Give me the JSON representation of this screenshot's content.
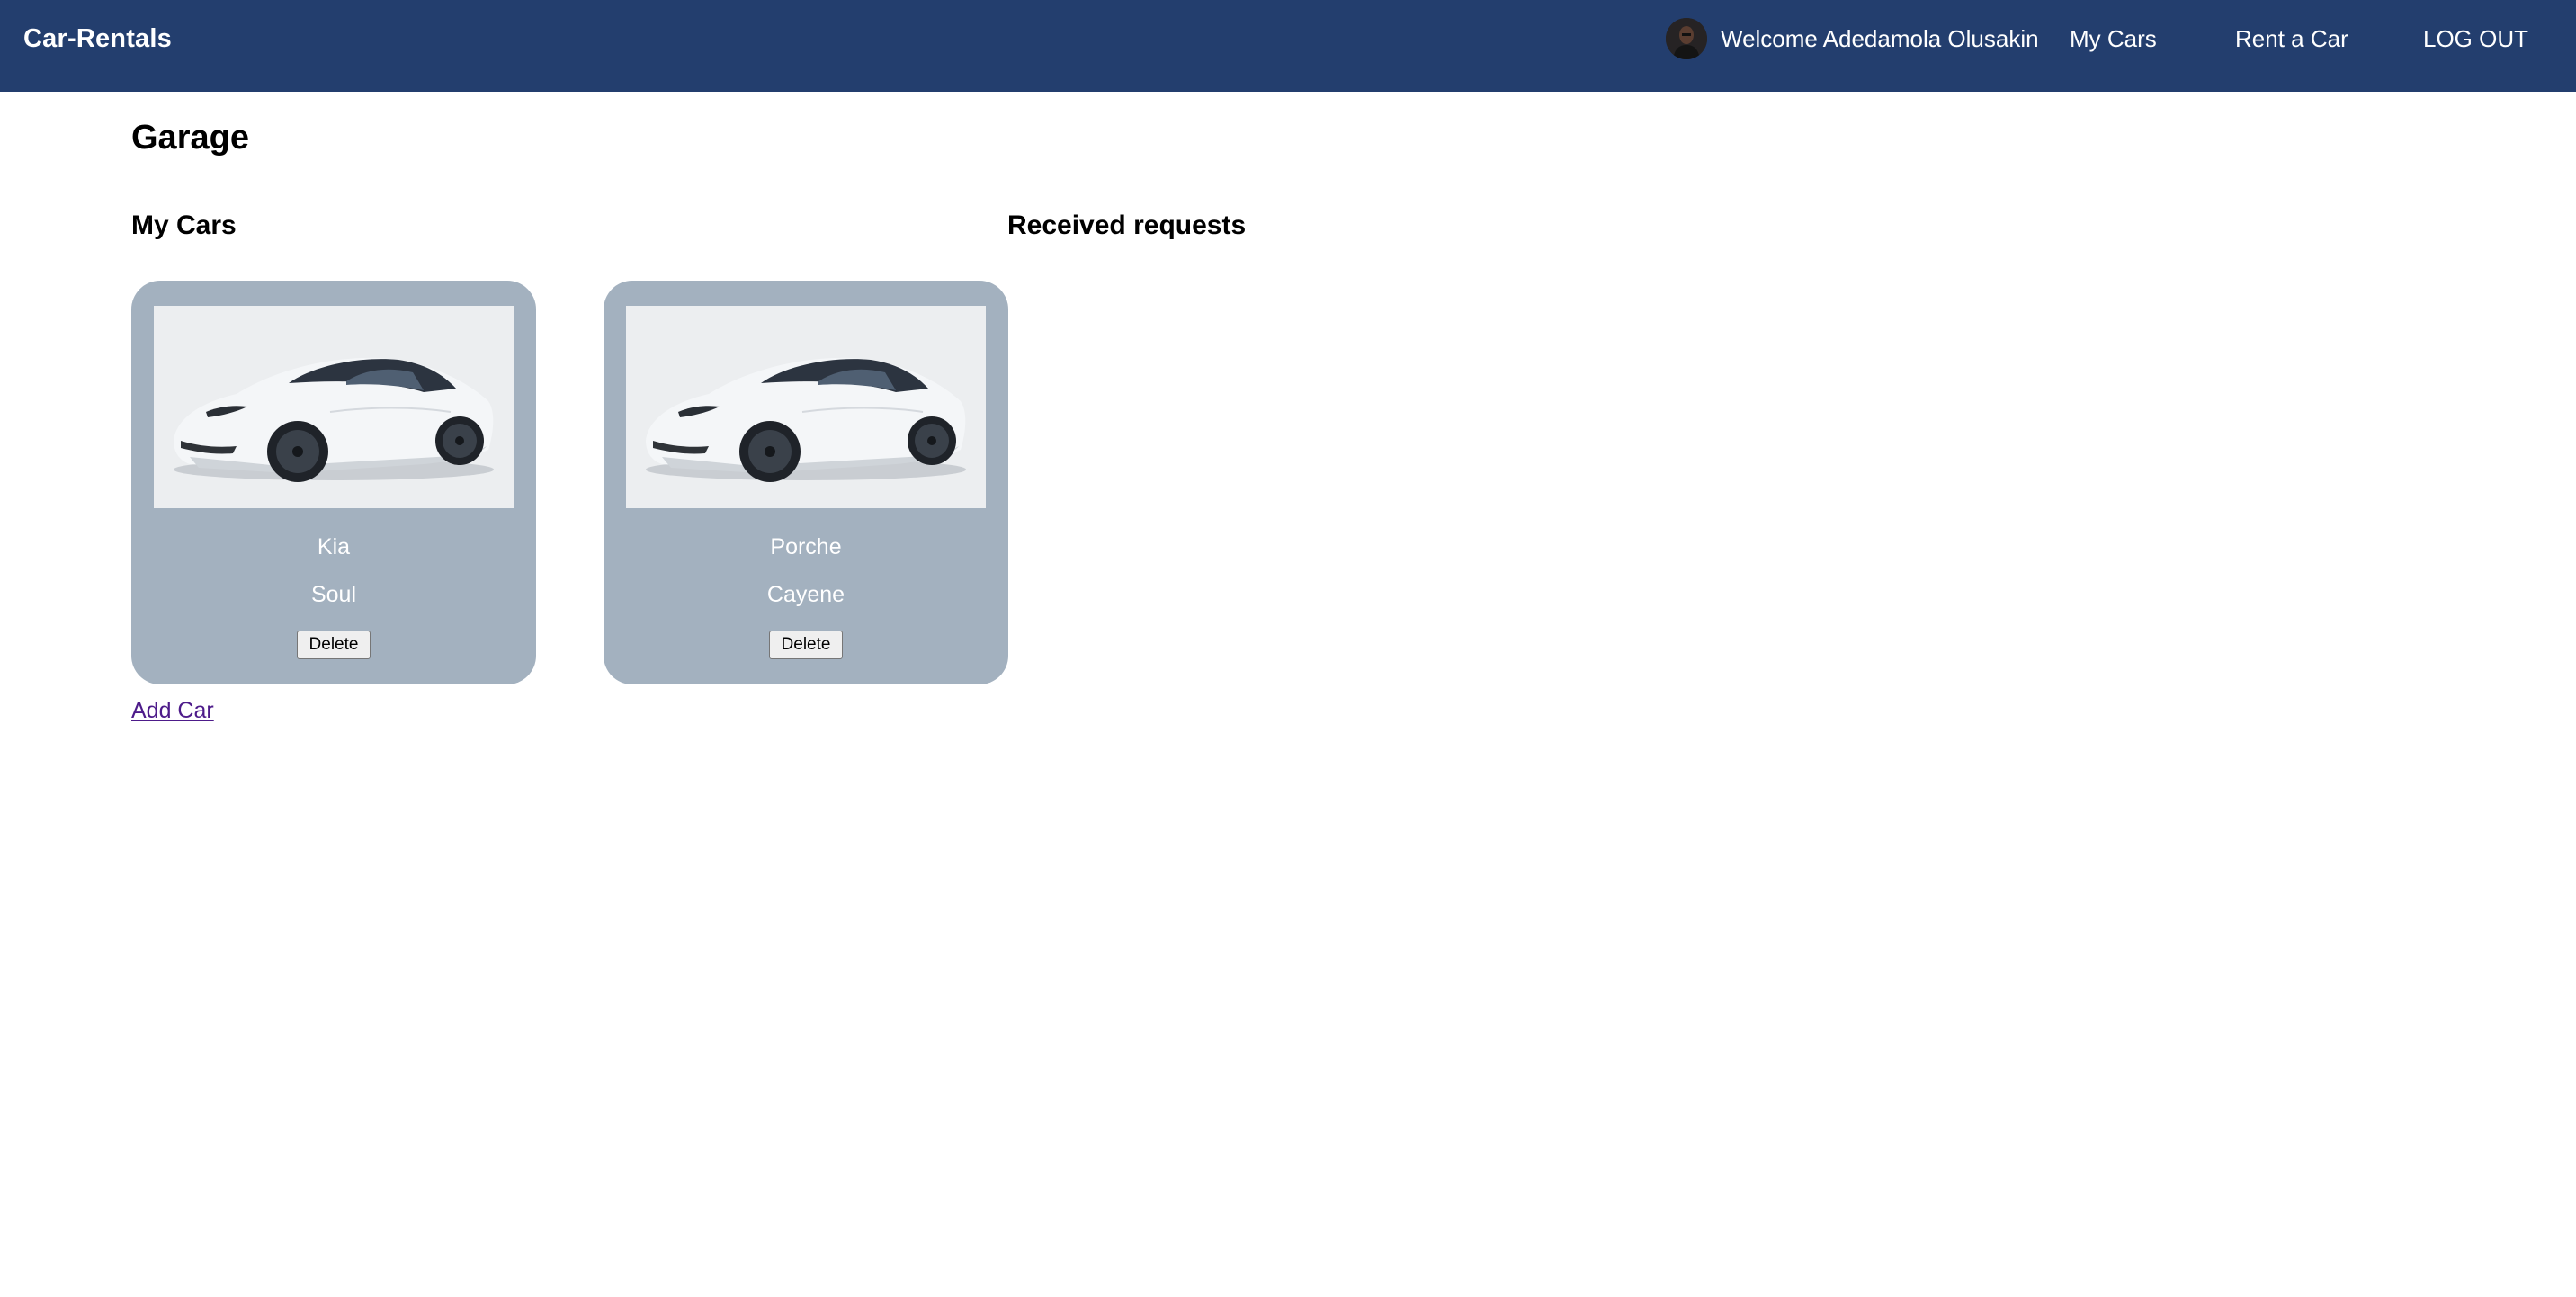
{
  "navbar": {
    "brand": "Car-Rentals",
    "welcome": "Welcome Adedamola Olusakin",
    "links": {
      "my_cars": "My Cars",
      "rent_a_car": "Rent a Car",
      "log_out": "LOG OUT"
    },
    "background_color": "#233e6e"
  },
  "page": {
    "title": "Garage",
    "my_cars_heading": "My Cars",
    "received_requests_heading": "Received requests",
    "add_car_label": "Add Car"
  },
  "cars": [
    {
      "make": "Kia",
      "model": "Soul",
      "delete_label": "Delete"
    },
    {
      "make": "Porche",
      "model": "Cayene",
      "delete_label": "Delete"
    }
  ],
  "colors": {
    "card_background": "#a3b1bf",
    "link_visited": "#4d1b8a"
  }
}
